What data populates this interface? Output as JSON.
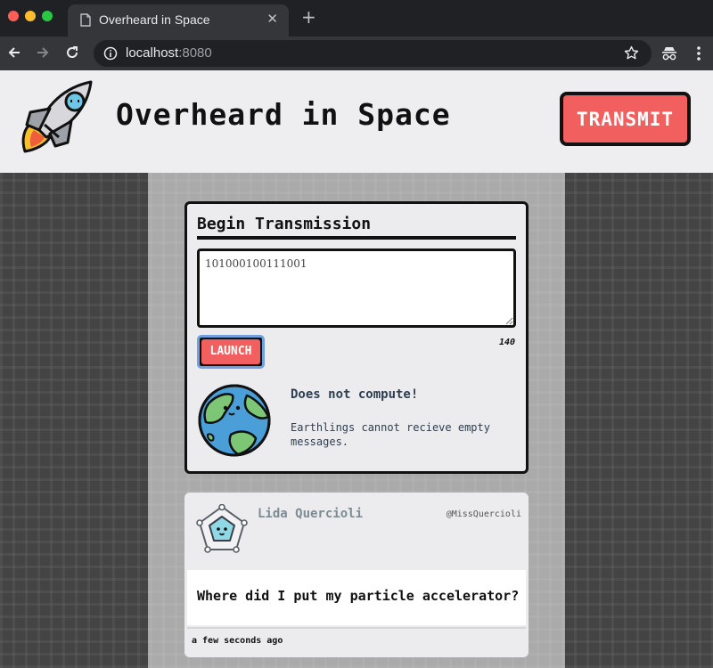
{
  "browser": {
    "tab_title": "Overheard in Space",
    "url_host": "localhost",
    "url_port": ":8080"
  },
  "header": {
    "site_title": "Overheard in Space",
    "transmit_label": "TRANSMIT"
  },
  "compose": {
    "title": "Begin Transmission",
    "input_value": "101000100111001",
    "launch_label": "LAUNCH",
    "char_count": "140",
    "error_title": "Does not compute!",
    "error_message": "Earthlings cannot recieve empty messages."
  },
  "posts": [
    {
      "name": "Lida Quercioli",
      "handle": "@MissQuercioli",
      "text": "Where did I put my particle accelerator?",
      "time": "a few seconds ago"
    }
  ],
  "colors": {
    "accent_red": "#f25f5f",
    "header_bg": "#eeeef0",
    "text_dark": "#111111",
    "focus_ring": "#6fa0e0"
  },
  "icons": [
    "document-icon",
    "close-icon",
    "plus-icon",
    "back-arrow-icon",
    "forward-arrow-icon",
    "reload-icon",
    "info-icon",
    "star-icon",
    "incognito-icon",
    "kebab-menu-icon",
    "rocket-logo-icon",
    "earth-icon",
    "alien-avatar-icon"
  ]
}
